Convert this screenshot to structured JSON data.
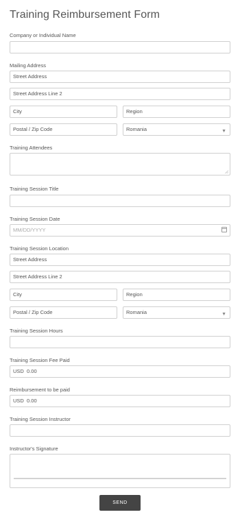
{
  "form": {
    "title": "Training Reimbursement Form",
    "company": {
      "label": "Company or Individual Name",
      "value": ""
    },
    "mailing": {
      "label": "Mailing Address",
      "street": "Street Address",
      "street2": "Street Address Line 2",
      "city": "City",
      "region": "Region",
      "postal": "Postal / Zip Code",
      "country": "Romania"
    },
    "attendees": {
      "label": "Training Attendees"
    },
    "session_title": {
      "label": "Training Session Title"
    },
    "session_date": {
      "label": "Training Session Date",
      "placeholder": "MM/DD/YYYY"
    },
    "location": {
      "label": "Training Session Location",
      "street": "Street Address",
      "street2": "Street Address Line 2",
      "city": "City",
      "region": "Region",
      "postal": "Postal / Zip Code",
      "country": "Romania"
    },
    "hours": {
      "label": "Training Session Hours"
    },
    "fee": {
      "label": "Training Session Fee Paid",
      "currency": "USD",
      "amount": "0.00"
    },
    "reimbursement": {
      "label": "Reimbursement to be paid",
      "currency": "USD",
      "amount": "0.00"
    },
    "instructor": {
      "label": "Training Session Instructor"
    },
    "signature": {
      "label": "Instructor's Signature"
    },
    "send_label": "SEND"
  },
  "icons": {
    "dropdown": "chevron-down-icon",
    "date": "calendar-icon",
    "resize": "resize-handle-icon"
  }
}
